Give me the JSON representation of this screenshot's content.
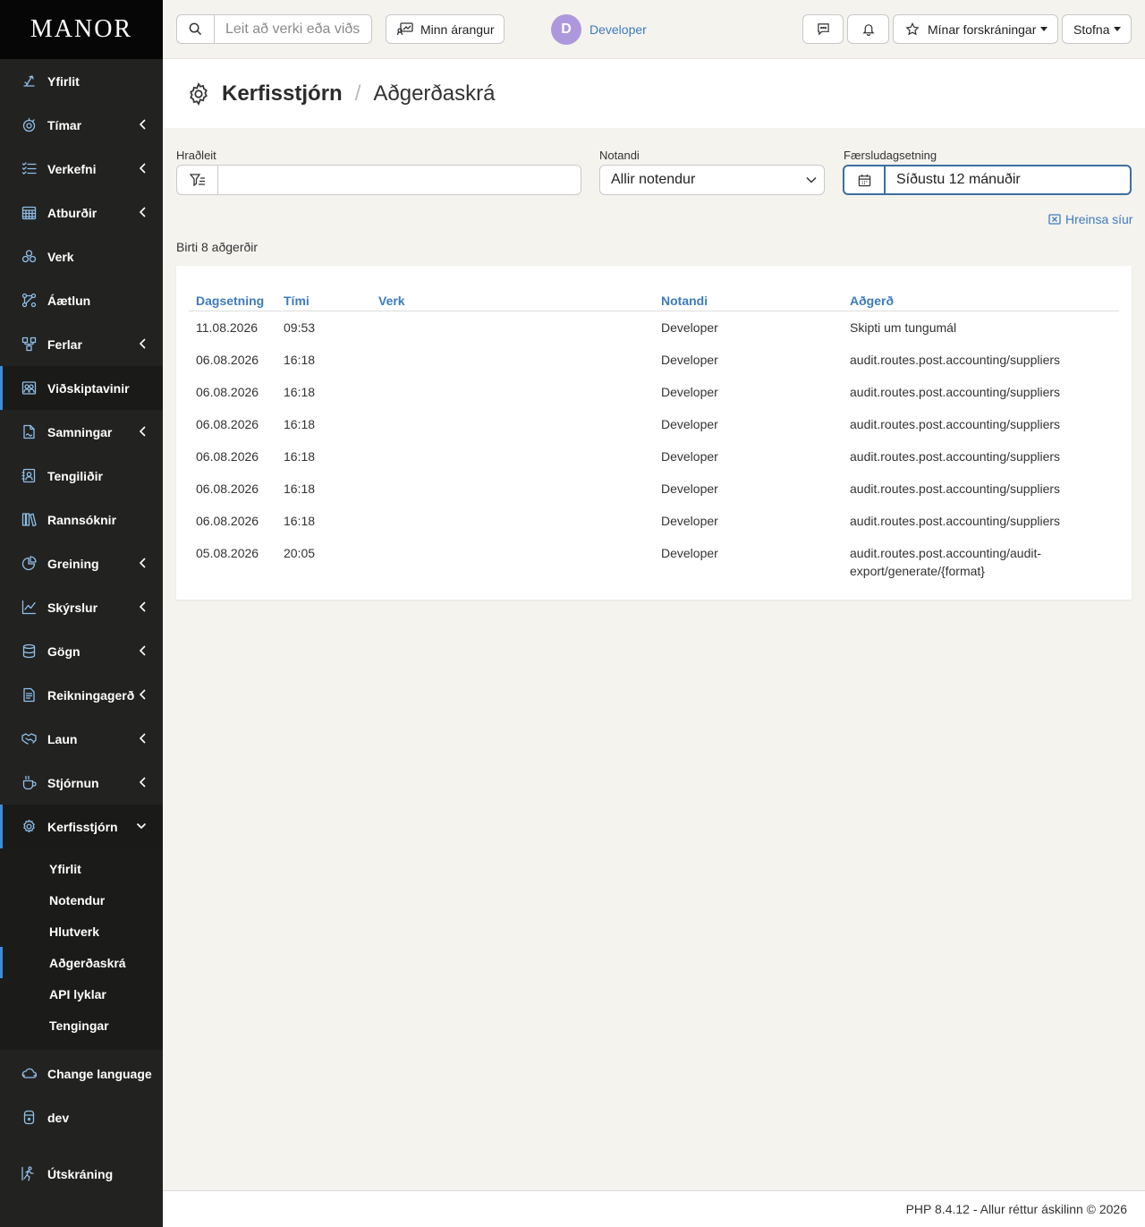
{
  "brand": "MANOR",
  "sidebar": {
    "items": [
      {
        "label": "Yfirlit",
        "icon": "dashboard-icon"
      },
      {
        "label": "Tímar",
        "icon": "stopwatch-icon",
        "expandable": true
      },
      {
        "label": "Verkefni",
        "icon": "tasks-list-icon",
        "expandable": true
      },
      {
        "label": "Atburðir",
        "icon": "calendar-icon",
        "expandable": true
      },
      {
        "label": "Verk",
        "icon": "cubes-icon"
      },
      {
        "label": "Áætlun",
        "icon": "plan-icon"
      },
      {
        "label": "Ferlar",
        "icon": "workflow-icon",
        "expandable": true
      },
      {
        "label": "Viðskiptavinir",
        "icon": "customers-icon",
        "active": true
      },
      {
        "label": "Samningar",
        "icon": "contract-icon",
        "expandable": true
      },
      {
        "label": "Tengiliðir",
        "icon": "contact-card-icon"
      },
      {
        "label": "Rannsóknir",
        "icon": "books-icon"
      },
      {
        "label": "Greining",
        "icon": "pie-chart-icon",
        "expandable": true
      },
      {
        "label": "Skýrslur",
        "icon": "line-chart-icon",
        "expandable": true
      },
      {
        "label": "Gögn",
        "icon": "database-icon",
        "expandable": true
      },
      {
        "label": "Reikningagerð",
        "icon": "invoice-icon",
        "expandable": true
      },
      {
        "label": "Laun",
        "icon": "handshake-icon",
        "expandable": true
      },
      {
        "label": "Stjórnun",
        "icon": "coffee-icon",
        "expandable": true
      },
      {
        "label": "Kerfisstjórn",
        "icon": "gear-icon",
        "expanded": true
      }
    ],
    "submenu": [
      {
        "label": "Yfirlit"
      },
      {
        "label": "Notendur"
      },
      {
        "label": "Hlutverk"
      },
      {
        "label": "Aðgerðaskrá",
        "active": true
      },
      {
        "label": "API lyklar"
      },
      {
        "label": "Tengingar"
      }
    ],
    "bottom": [
      {
        "label": "Change language",
        "icon": "cloud-icon"
      },
      {
        "label": "dev",
        "icon": "server-icon"
      },
      {
        "label": "Útskráning",
        "icon": "logout-runner-icon"
      }
    ]
  },
  "topbar": {
    "search_placeholder": "Leit að verki eða viðs",
    "achievements_label": "Minn árangur",
    "user_initial": "D",
    "user_name": "Developer",
    "favorites_label": "Mínar forskráningar",
    "create_label": "Stofna"
  },
  "header": {
    "section": "Kerfisstjórn",
    "separator": "/",
    "page": "Aðgerðaskrá"
  },
  "filters": {
    "quick_label": "Hraðleit",
    "quick_value": "",
    "user_label": "Notandi",
    "user_value": "Allir notendur",
    "date_label": "Færsludagsetning",
    "date_value": "Síðustu 12 mánuðir",
    "clear_label": "Hreinsa síur"
  },
  "result_count": "Birti 8 aðgerðir",
  "table": {
    "columns": [
      "Dagsetning",
      "Tími",
      "Verk",
      "Notandi",
      "Aðgerð"
    ],
    "rows": [
      {
        "date": "11.08.2026",
        "time": "09:53",
        "project": "",
        "user": "Developer",
        "action": "Skipti um tungumál"
      },
      {
        "date": "06.08.2026",
        "time": "16:18",
        "project": "",
        "user": "Developer",
        "action": "audit.routes.post.accounting/suppliers"
      },
      {
        "date": "06.08.2026",
        "time": "16:18",
        "project": "",
        "user": "Developer",
        "action": "audit.routes.post.accounting/suppliers"
      },
      {
        "date": "06.08.2026",
        "time": "16:18",
        "project": "",
        "user": "Developer",
        "action": "audit.routes.post.accounting/suppliers"
      },
      {
        "date": "06.08.2026",
        "time": "16:18",
        "project": "",
        "user": "Developer",
        "action": "audit.routes.post.accounting/suppliers"
      },
      {
        "date": "06.08.2026",
        "time": "16:18",
        "project": "",
        "user": "Developer",
        "action": "audit.routes.post.accounting/suppliers"
      },
      {
        "date": "06.08.2026",
        "time": "16:18",
        "project": "",
        "user": "Developer",
        "action": "audit.routes.post.accounting/suppliers"
      },
      {
        "date": "05.08.2026",
        "time": "20:05",
        "project": "",
        "user": "Developer",
        "action": "audit.routes.post.accounting/audit-export/generate/{format}"
      }
    ]
  },
  "footer": "PHP 8.4.12 - Allur réttur áskilinn © 2026",
  "colors": {
    "sidebar_bg": "#222220",
    "accent": "#3c8dd9",
    "link": "#3d7bbf",
    "page_bg": "#f4f3ee"
  }
}
